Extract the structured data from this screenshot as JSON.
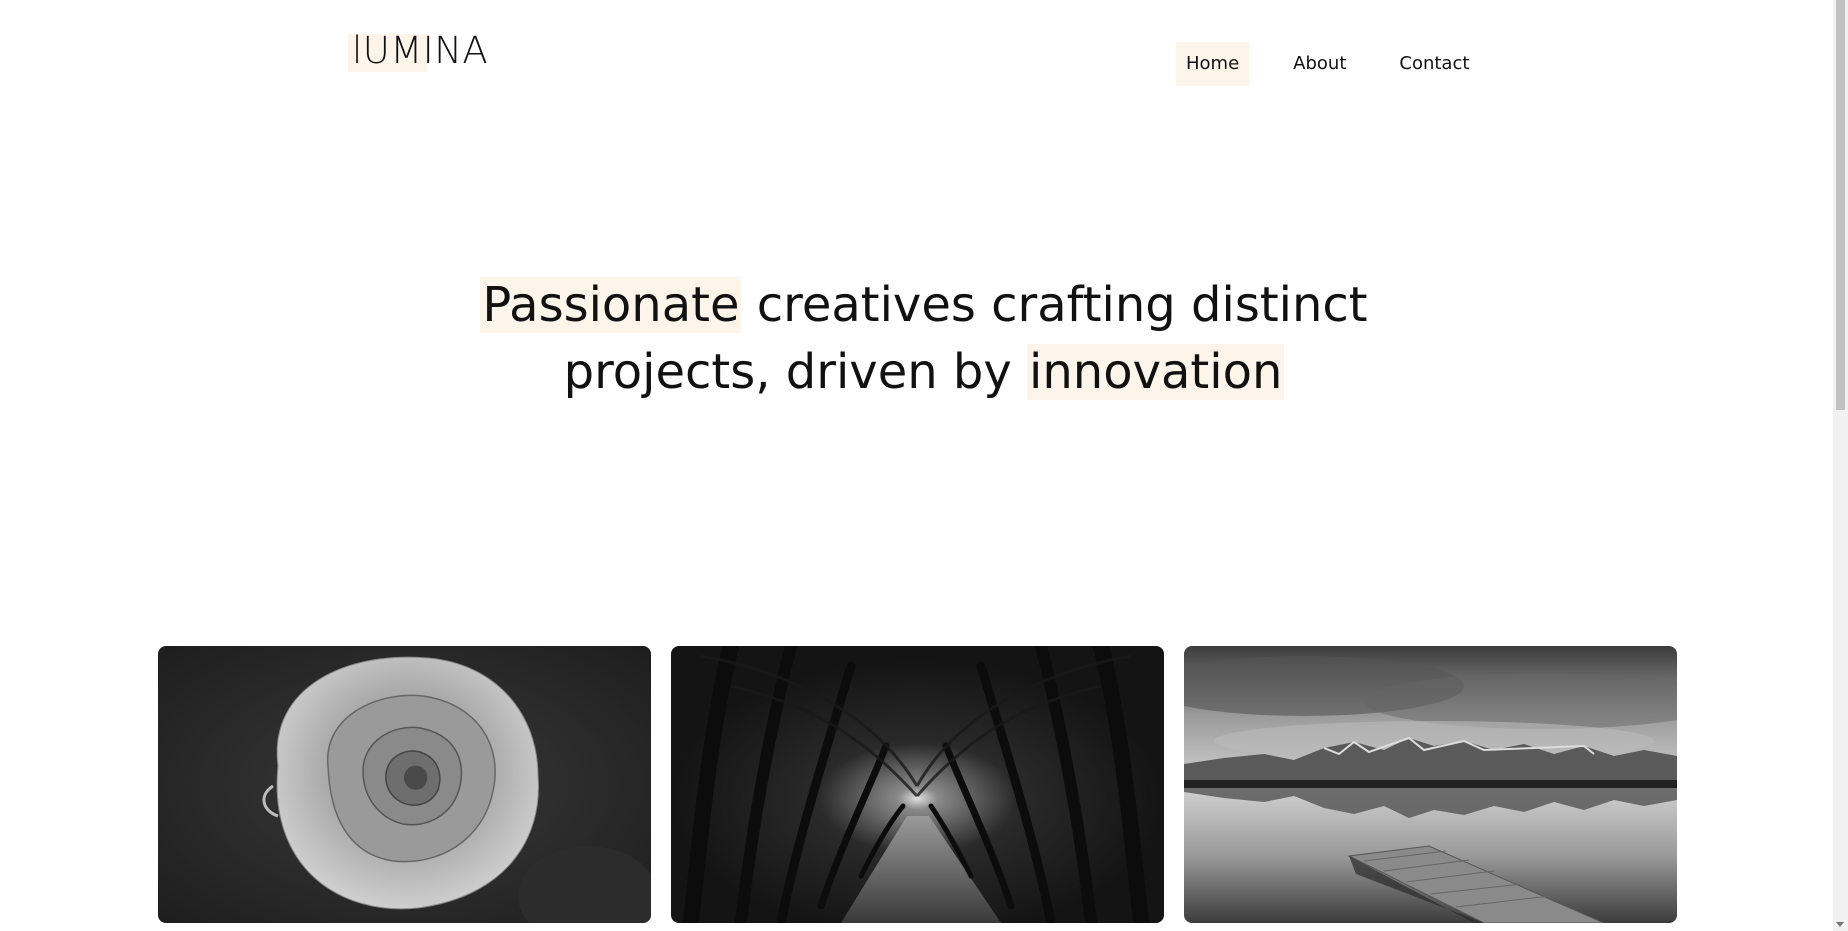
{
  "header": {
    "logo_text": "lUMINA",
    "nav": [
      {
        "label": "Home",
        "active": true
      },
      {
        "label": "About",
        "active": false
      },
      {
        "label": "Contact",
        "active": false
      }
    ]
  },
  "hero": {
    "line1_highlight": "Passionate",
    "line1_rest": " creatives crafting distinct",
    "line2_rest": "projects, driven by ",
    "line2_highlight": "innovation"
  },
  "gallery": [
    {
      "subject": "rose"
    },
    {
      "subject": "tree-tunnel-path"
    },
    {
      "subject": "mountain-lake-pier"
    }
  ],
  "colors": {
    "highlight": "#fdf5ea",
    "text": "#111111",
    "background": "#ffffff"
  }
}
